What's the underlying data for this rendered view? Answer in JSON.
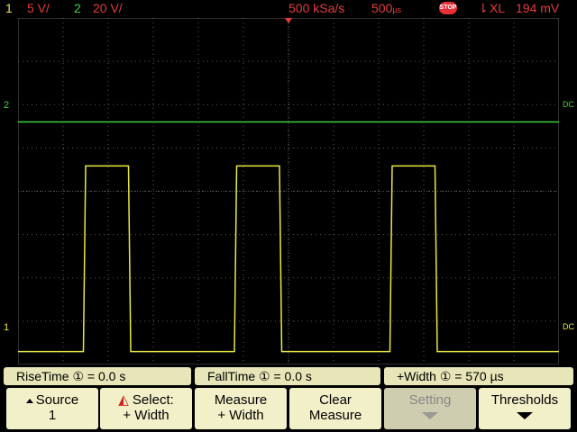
{
  "status": {
    "ch1_num": "1",
    "ch1_scale": "5 V/",
    "ch2_num": "2",
    "ch2_scale": "20 V/",
    "sample_rate": "500 kSa/s",
    "timebase": "500",
    "timebase_unit": "µs",
    "stop_label": "STOP",
    "trigger_source": "XL",
    "trigger_level": "194 mV"
  },
  "markers": {
    "ch2_marker": "2",
    "ch1_marker": "1",
    "dc_label_ch2": "DC",
    "dc_label_ch1": "DC"
  },
  "measurements": [
    {
      "label": "RiseTime ① =  0.0 s"
    },
    {
      "label": "FallTime ① =  0.0 s"
    },
    {
      "label": "+Width ① = 570 µs"
    }
  ],
  "softkeys": [
    {
      "line1": "Source",
      "line2": "1"
    },
    {
      "line1": "Select:",
      "line2": "+ Width"
    },
    {
      "line1": "Measure",
      "line2": "+ Width"
    },
    {
      "line1": "Clear",
      "line2": "Measure"
    },
    {
      "line1": "Setting",
      "line2": ""
    },
    {
      "line1": "Thresholds",
      "line2": ""
    }
  ],
  "colors": {
    "ch1": "#e8e840",
    "ch2": "#3fd23f",
    "grid": "#5a5a5a",
    "accent_red": "#e63b3b"
  },
  "chart_data": {
    "type": "line",
    "title": "",
    "xlabel": "",
    "ylabel": "",
    "x_divisions": 12,
    "y_divisions": 8,
    "series": [
      {
        "channel": "ch1",
        "x_div": [
          0,
          1.45,
          1.5,
          2.45,
          2.5,
          4.8,
          4.85,
          5.8,
          5.85,
          8.25,
          8.3,
          9.25,
          9.3,
          12
        ],
        "y_div": [
          0.0,
          0.0,
          4.5,
          4.5,
          0.0,
          0.0,
          4.5,
          4.5,
          0.0,
          0.0,
          4.5,
          4.5,
          0.0,
          0.0
        ]
      },
      {
        "channel": "ch2",
        "x_div": [
          0,
          12
        ],
        "y_div": [
          5.0,
          5.0
        ]
      }
    ],
    "grid": true
  }
}
